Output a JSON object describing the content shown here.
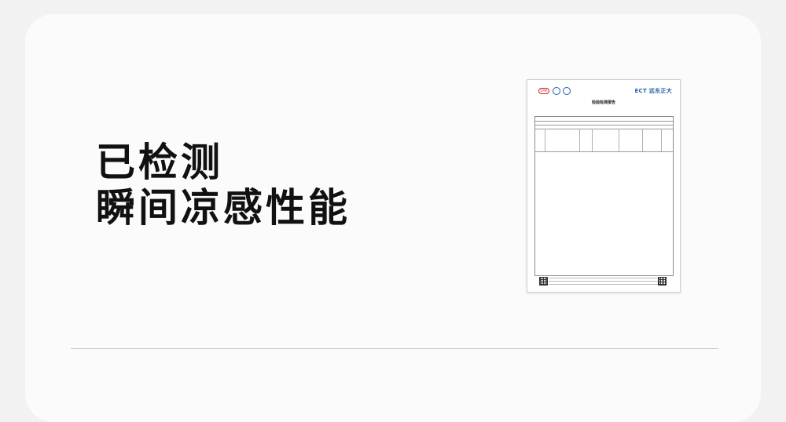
{
  "headline": {
    "line1": "已检测",
    "line2": "瞬间凉感性能"
  },
  "report": {
    "brand": "ECT 远东正大",
    "title": "检验检测报告",
    "logo_cma": "CMA"
  },
  "icons": {
    "report_qr_left": "qr-code-icon",
    "report_qr_right": "qr-code-icon"
  }
}
